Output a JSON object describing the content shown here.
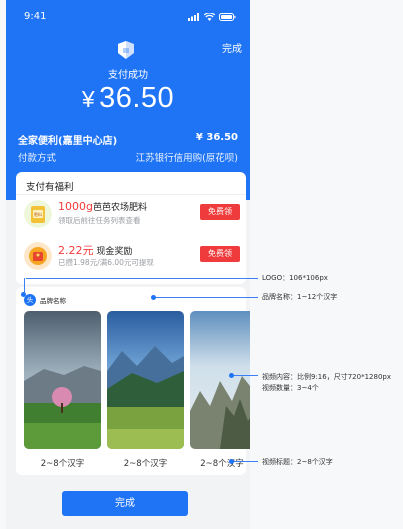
{
  "status": {
    "time": "9:41"
  },
  "header": {
    "done_label": "完成",
    "success_title": "支付成功",
    "currency": "¥",
    "amount": "36.50"
  },
  "payment": {
    "merchant": "全家便利(嘉里中心店)",
    "merchant_amount": "¥ 36.50",
    "method_label": "付款方式",
    "method_value": "江苏银行信用购(原花呗)"
  },
  "benefits": {
    "title": "支付有福利",
    "items": [
      {
        "highlight": "1000g",
        "text": "芭芭农场肥料",
        "sub": "领取后前往任务列表查看",
        "button": "免费领",
        "icon_label": "肥料"
      },
      {
        "highlight": "2.22元",
        "text": " 现金奖励",
        "sub": "已攒1.98元/满6.00元可提现",
        "button": "免费领"
      }
    ]
  },
  "brand": {
    "logo_char": "头",
    "name": "品牌名称"
  },
  "videos": [
    {
      "title": "2~8个汉字"
    },
    {
      "title": "2~8个汉字"
    },
    {
      "title": "2~8个汉字"
    }
  ],
  "footer": {
    "done_button": "完成"
  },
  "annotations": {
    "logo": "LOGO：106*106px",
    "brand_name": "品牌名称：1~12个汉字",
    "video_content_1": "视频内容：比例9:16，尺寸720*1280px",
    "video_content_2": "视频数量：3~4个",
    "video_title": "视频标题：2~8个汉字"
  },
  "colors": {
    "brand_blue": "#1f74f5",
    "red_button": "#ef3b3b",
    "highlight_red": "#f23b3b"
  }
}
